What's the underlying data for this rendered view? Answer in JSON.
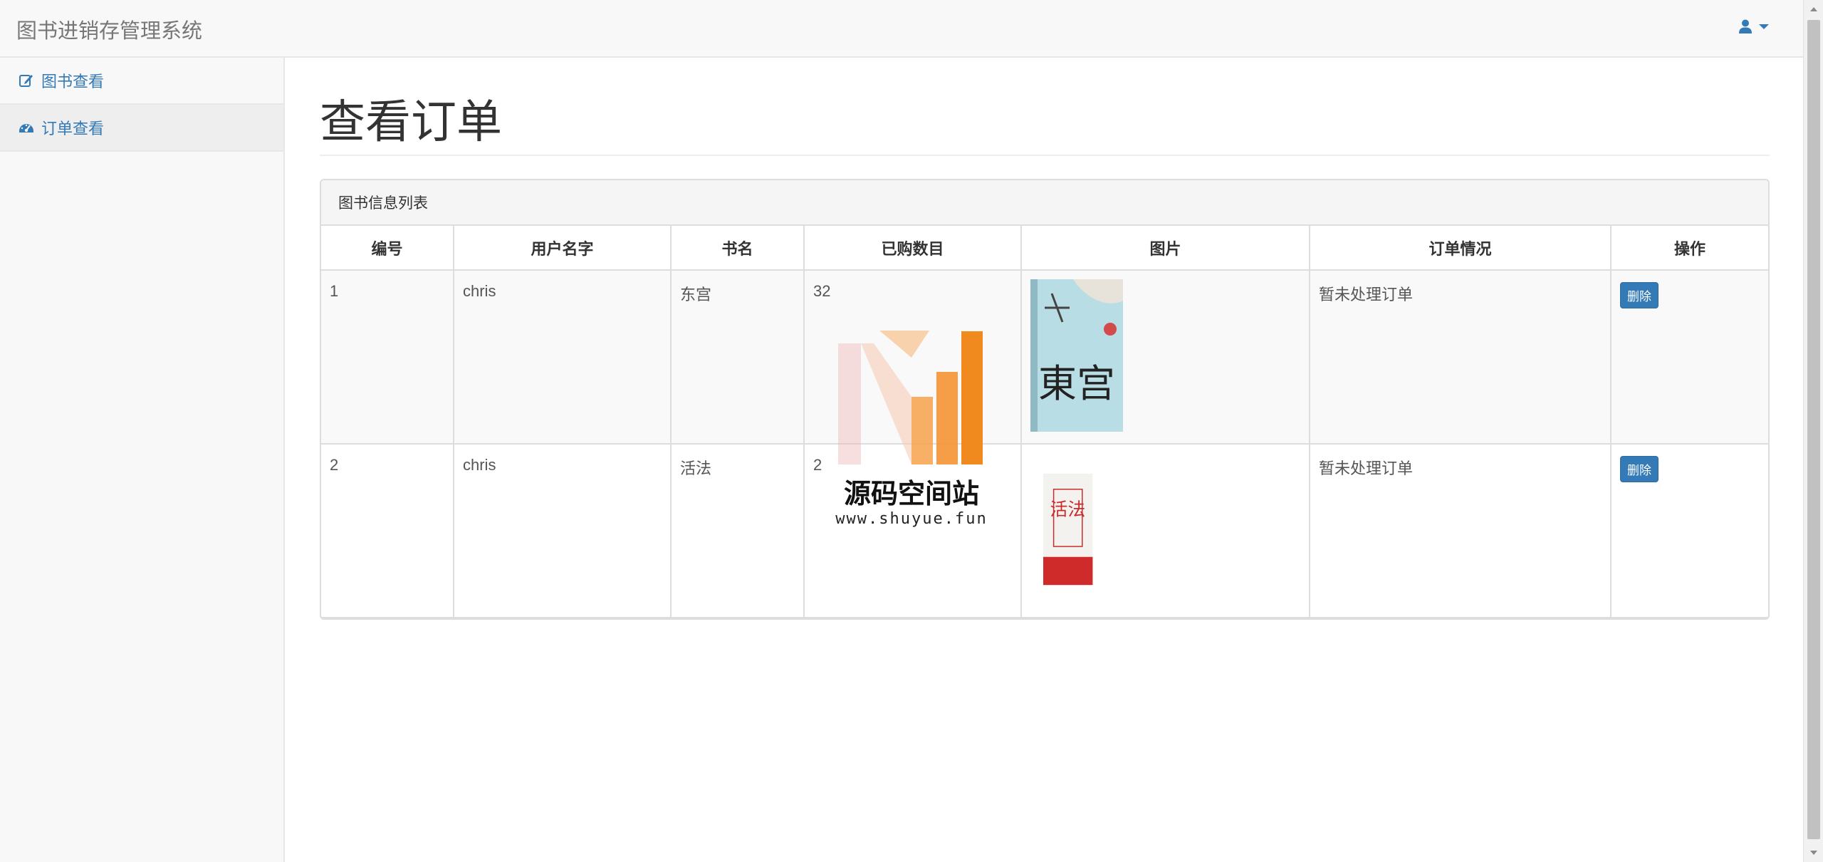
{
  "app": {
    "brand": "图书进销存管理系统"
  },
  "header": {
    "user_icon": "user-icon"
  },
  "sidebar": {
    "items": [
      {
        "label": "图书查看",
        "icon": "edit-icon",
        "active": false
      },
      {
        "label": "订单查看",
        "icon": "dashboard-icon",
        "active": true
      }
    ]
  },
  "main": {
    "title": "查看订单",
    "panel_title": "图书信息列表",
    "columns": [
      "编号",
      "用户名字",
      "书名",
      "已购数目",
      "图片",
      "订单情况",
      "操作"
    ],
    "rows": [
      {
        "id": "1",
        "user": "chris",
        "book": "东宫",
        "qty": "32",
        "cover_text": "東宫",
        "status": "暂未处理订单",
        "action": "删除"
      },
      {
        "id": "2",
        "user": "chris",
        "book": "活法",
        "qty": "2",
        "cover_text": "活法",
        "status": "暂未处理订单",
        "action": "删除"
      }
    ]
  },
  "watermark": {
    "text": "源码空间站",
    "url": "www.shuyue.fun"
  },
  "colors": {
    "link": "#337ab7",
    "button": "#337ab7",
    "border": "#dddddd"
  }
}
